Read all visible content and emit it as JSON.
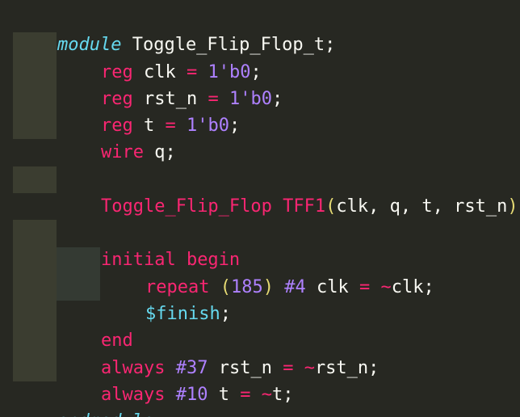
{
  "code": {
    "l1": {
      "kw": "module",
      "name": " Toggle_Flip_Flop_t;"
    },
    "l2": {
      "kw": "reg",
      "a": " clk ",
      "op": "=",
      "sp": " ",
      "num": "1'b0",
      "end": ";"
    },
    "l3": {
      "kw": "reg",
      "a": " rst_n ",
      "op": "=",
      "sp": " ",
      "num": "1'b0",
      "end": ";"
    },
    "l4": {
      "kw": "reg",
      "a": " t ",
      "op": "=",
      "sp": " ",
      "num": "1'b0",
      "end": ";"
    },
    "l5": {
      "kw": "wire",
      "a": " q;"
    },
    "l7": {
      "kw": "Toggle_Flip_Flop",
      "sp": " ",
      "inst": "TFF1",
      "lp": "(",
      "args": "clk, q, t, rst_n",
      "rp": ")",
      "end": ";"
    },
    "l9": {
      "kw": "initial begin"
    },
    "l10": {
      "kw": "repeat",
      "sp": " ",
      "lp": "(",
      "num": "185",
      "rp": ")",
      "sp2": " ",
      "delay": "#4",
      "a": " clk ",
      "op": "=",
      "sp3": " ",
      "tilde": "~",
      "b": "clk;"
    },
    "l11": {
      "sys": "$finish",
      "end": ";"
    },
    "l12": {
      "kw": "end"
    },
    "l13": {
      "kw": "always",
      "sp": " ",
      "delay": "#37",
      "a": " rst_n ",
      "op": "=",
      "sp2": " ",
      "tilde": "~",
      "b": "rst_n;"
    },
    "l14": {
      "kw": "always",
      "sp": " ",
      "delay": "#10",
      "a": " t ",
      "op": "=",
      "sp2": " ",
      "tilde": "~",
      "b": "t;"
    },
    "l15": {
      "kw": "endmodule"
    }
  },
  "theme": {
    "background": "#272822",
    "keyword": "#f92672",
    "number": "#ae81ff",
    "type": "#66d9ef",
    "paren": "#e6db74",
    "text": "#f8f8f2"
  }
}
